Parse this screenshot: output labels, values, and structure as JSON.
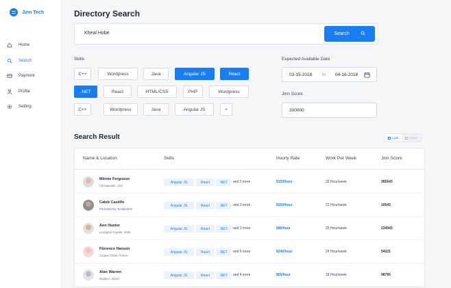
{
  "app": {
    "name": "Jinn Tech"
  },
  "sidebar": {
    "items": [
      {
        "label": "Home",
        "icon": "home-icon"
      },
      {
        "label": "Search",
        "icon": "search-icon",
        "active": true
      },
      {
        "label": "Payment",
        "icon": "card-icon"
      },
      {
        "label": "Profile",
        "icon": "user-icon"
      },
      {
        "label": "Setting",
        "icon": "gear-icon"
      }
    ]
  },
  "page": {
    "title": "Directory Search"
  },
  "search": {
    "value": "Kheal Hobe",
    "button_label": "Search"
  },
  "skills": {
    "label": "Skills",
    "rows": [
      [
        {
          "label": "C++",
          "selected": false
        },
        {
          "label": "Wordpress",
          "selected": false
        },
        {
          "label": "Java",
          "selected": false
        },
        {
          "label": "Angular JS",
          "selected": true
        },
        {
          "label": "React",
          "selected": true
        }
      ],
      [
        {
          "label": ".NET",
          "selected": true
        },
        {
          "label": "React",
          "selected": false
        },
        {
          "label": "HTML/CSS",
          "selected": false
        },
        {
          "label": "PHP",
          "selected": false
        },
        {
          "label": "Wordpress",
          "selected": false
        }
      ],
      [
        {
          "label": "C++",
          "selected": false
        },
        {
          "label": "Wordpress",
          "selected": false
        },
        {
          "label": "Java",
          "selected": false
        },
        {
          "label": "Angular JS",
          "selected": false
        },
        {
          "label": "+",
          "selected": false
        }
      ]
    ]
  },
  "availability": {
    "label": "Expected Available Date",
    "from": "03-15-2018",
    "to_label": "to",
    "to": "04-16-2018"
  },
  "jinn_score": {
    "label": "Jinn Score",
    "value": "300000"
  },
  "results": {
    "title": "Search Result",
    "view_toggle": {
      "lists": "Lists",
      "cards": "Cards",
      "active": "lists"
    },
    "columns": {
      "name": "Name & Location",
      "skills": "Skills",
      "rate": "Hourly Rate",
      "work": "Work Per Week",
      "score": "Jinn Score"
    },
    "rows": [
      {
        "name": "Minnie Ferguson",
        "location": "Chesapeake, USA",
        "tags": [
          "Angular JS",
          "React",
          ".NET"
        ],
        "more": "and 2 more",
        "rate": "$150/hour",
        "work": "32 Hour/week",
        "score": "365543"
      },
      {
        "name": "Caleb Castillo",
        "location": "Phuladelphia, Bangladesh",
        "tags": [
          "Angular JS",
          "React",
          ".NET"
        ],
        "more": "and 3 more",
        "rate": "$200/hour",
        "work": "21 Hour/week",
        "score": "10543"
      },
      {
        "name": "Ann Hunter",
        "location": "Lexington-Fayette, India",
        "tags": [
          "Angular JS",
          "React",
          ".NET"
        ],
        "more": "and 1 more",
        "rate": "$90/hour",
        "work": "25 Hour/week",
        "score": "234543"
      },
      {
        "name": "Florence Hanson",
        "location": "Corpus Christi, France",
        "tags": [
          "Angular JS",
          "React",
          ".NET"
        ],
        "more": "and 6 more",
        "rate": "$240/hour",
        "work": "24 Hour/week",
        "score": "54321"
      },
      {
        "name": "Alan Warren",
        "location": "Madison, Brazil",
        "tags": [
          "Angular JS",
          "React",
          ".NET"
        ],
        "more": "and 4 more",
        "rate": "$50/hour",
        "work": "18 Hour/week",
        "score": "98765"
      }
    ]
  },
  "colors": {
    "accent": "#1a7df0",
    "tag_bg": "#e9f2fd",
    "page_bg": "#f5f6f8"
  }
}
